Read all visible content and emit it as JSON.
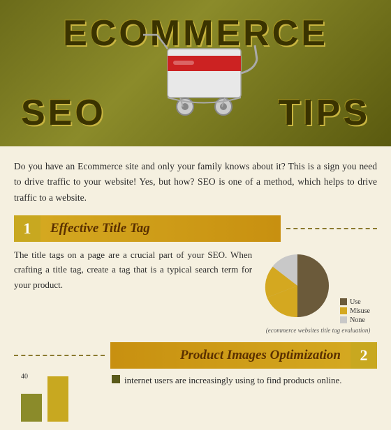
{
  "header": {
    "title_top": "ECOMMERCE",
    "seo": "SEO",
    "tips": "TIPS"
  },
  "intro": {
    "text": "Do you have an Ecommerce site and only your family knows about it? This is a sign you need to drive traffic to your website! Yes, but how? SEO is one of a method, which helps to drive traffic to a website."
  },
  "section1": {
    "number": "1",
    "title": "Effective Title Tag",
    "text": "The title tags on a page are a crucial part of your SEO. When crafting a title tag, create a tag that is a typical search term for your product.",
    "pie": {
      "caption": "(ecommerce websites title tag evaluation)",
      "legend": [
        {
          "color": "#8b7355",
          "label": "Use"
        },
        {
          "color": "#d4a820",
          "label": "Misuse"
        },
        {
          "color": "#c8c8c8",
          "label": "None"
        }
      ]
    }
  },
  "section2": {
    "number": "2",
    "title": "Product Images Optimization",
    "bar_label": "40",
    "bar1_height": 40,
    "bar2_height": 65,
    "text": "internet users are increasingly using to find products online."
  }
}
